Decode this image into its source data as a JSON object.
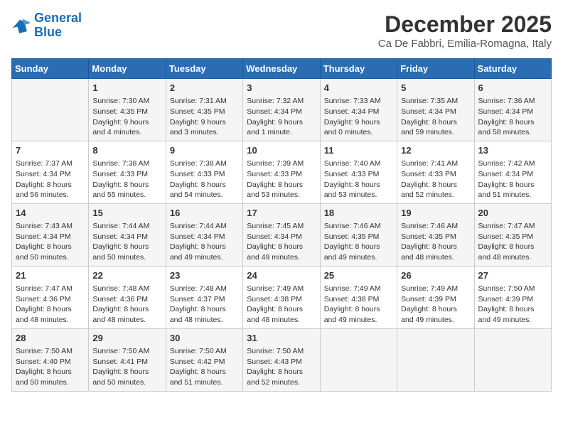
{
  "logo": {
    "line1": "General",
    "line2": "Blue"
  },
  "title": "December 2025",
  "subtitle": "Ca De Fabbri, Emilia-Romagna, Italy",
  "weekdays": [
    "Sunday",
    "Monday",
    "Tuesday",
    "Wednesday",
    "Thursday",
    "Friday",
    "Saturday"
  ],
  "weeks": [
    [
      {
        "day": "",
        "info": ""
      },
      {
        "day": "1",
        "info": "Sunrise: 7:30 AM\nSunset: 4:35 PM\nDaylight: 9 hours\nand 4 minutes."
      },
      {
        "day": "2",
        "info": "Sunrise: 7:31 AM\nSunset: 4:35 PM\nDaylight: 9 hours\nand 3 minutes."
      },
      {
        "day": "3",
        "info": "Sunrise: 7:32 AM\nSunset: 4:34 PM\nDaylight: 9 hours\nand 1 minute."
      },
      {
        "day": "4",
        "info": "Sunrise: 7:33 AM\nSunset: 4:34 PM\nDaylight: 9 hours\nand 0 minutes."
      },
      {
        "day": "5",
        "info": "Sunrise: 7:35 AM\nSunset: 4:34 PM\nDaylight: 8 hours\nand 59 minutes."
      },
      {
        "day": "6",
        "info": "Sunrise: 7:36 AM\nSunset: 4:34 PM\nDaylight: 8 hours\nand 58 minutes."
      }
    ],
    [
      {
        "day": "7",
        "info": "Sunrise: 7:37 AM\nSunset: 4:34 PM\nDaylight: 8 hours\nand 56 minutes."
      },
      {
        "day": "8",
        "info": "Sunrise: 7:38 AM\nSunset: 4:33 PM\nDaylight: 8 hours\nand 55 minutes."
      },
      {
        "day": "9",
        "info": "Sunrise: 7:38 AM\nSunset: 4:33 PM\nDaylight: 8 hours\nand 54 minutes."
      },
      {
        "day": "10",
        "info": "Sunrise: 7:39 AM\nSunset: 4:33 PM\nDaylight: 8 hours\nand 53 minutes."
      },
      {
        "day": "11",
        "info": "Sunrise: 7:40 AM\nSunset: 4:33 PM\nDaylight: 8 hours\nand 53 minutes."
      },
      {
        "day": "12",
        "info": "Sunrise: 7:41 AM\nSunset: 4:33 PM\nDaylight: 8 hours\nand 52 minutes."
      },
      {
        "day": "13",
        "info": "Sunrise: 7:42 AM\nSunset: 4:34 PM\nDaylight: 8 hours\nand 51 minutes."
      }
    ],
    [
      {
        "day": "14",
        "info": "Sunrise: 7:43 AM\nSunset: 4:34 PM\nDaylight: 8 hours\nand 50 minutes."
      },
      {
        "day": "15",
        "info": "Sunrise: 7:44 AM\nSunset: 4:34 PM\nDaylight: 8 hours\nand 50 minutes."
      },
      {
        "day": "16",
        "info": "Sunrise: 7:44 AM\nSunset: 4:34 PM\nDaylight: 8 hours\nand 49 minutes."
      },
      {
        "day": "17",
        "info": "Sunrise: 7:45 AM\nSunset: 4:34 PM\nDaylight: 8 hours\nand 49 minutes."
      },
      {
        "day": "18",
        "info": "Sunrise: 7:46 AM\nSunset: 4:35 PM\nDaylight: 8 hours\nand 49 minutes."
      },
      {
        "day": "19",
        "info": "Sunrise: 7:46 AM\nSunset: 4:35 PM\nDaylight: 8 hours\nand 48 minutes."
      },
      {
        "day": "20",
        "info": "Sunrise: 7:47 AM\nSunset: 4:35 PM\nDaylight: 8 hours\nand 48 minutes."
      }
    ],
    [
      {
        "day": "21",
        "info": "Sunrise: 7:47 AM\nSunset: 4:36 PM\nDaylight: 8 hours\nand 48 minutes."
      },
      {
        "day": "22",
        "info": "Sunrise: 7:48 AM\nSunset: 4:36 PM\nDaylight: 8 hours\nand 48 minutes."
      },
      {
        "day": "23",
        "info": "Sunrise: 7:48 AM\nSunset: 4:37 PM\nDaylight: 8 hours\nand 48 minutes."
      },
      {
        "day": "24",
        "info": "Sunrise: 7:49 AM\nSunset: 4:38 PM\nDaylight: 8 hours\nand 48 minutes."
      },
      {
        "day": "25",
        "info": "Sunrise: 7:49 AM\nSunset: 4:38 PM\nDaylight: 8 hours\nand 49 minutes."
      },
      {
        "day": "26",
        "info": "Sunrise: 7:49 AM\nSunset: 4:39 PM\nDaylight: 8 hours\nand 49 minutes."
      },
      {
        "day": "27",
        "info": "Sunrise: 7:50 AM\nSunset: 4:39 PM\nDaylight: 8 hours\nand 49 minutes."
      }
    ],
    [
      {
        "day": "28",
        "info": "Sunrise: 7:50 AM\nSunset: 4:40 PM\nDaylight: 8 hours\nand 50 minutes."
      },
      {
        "day": "29",
        "info": "Sunrise: 7:50 AM\nSunset: 4:41 PM\nDaylight: 8 hours\nand 50 minutes."
      },
      {
        "day": "30",
        "info": "Sunrise: 7:50 AM\nSunset: 4:42 PM\nDaylight: 8 hours\nand 51 minutes."
      },
      {
        "day": "31",
        "info": "Sunrise: 7:50 AM\nSunset: 4:43 PM\nDaylight: 8 hours\nand 52 minutes."
      },
      {
        "day": "",
        "info": ""
      },
      {
        "day": "",
        "info": ""
      },
      {
        "day": "",
        "info": ""
      }
    ]
  ]
}
